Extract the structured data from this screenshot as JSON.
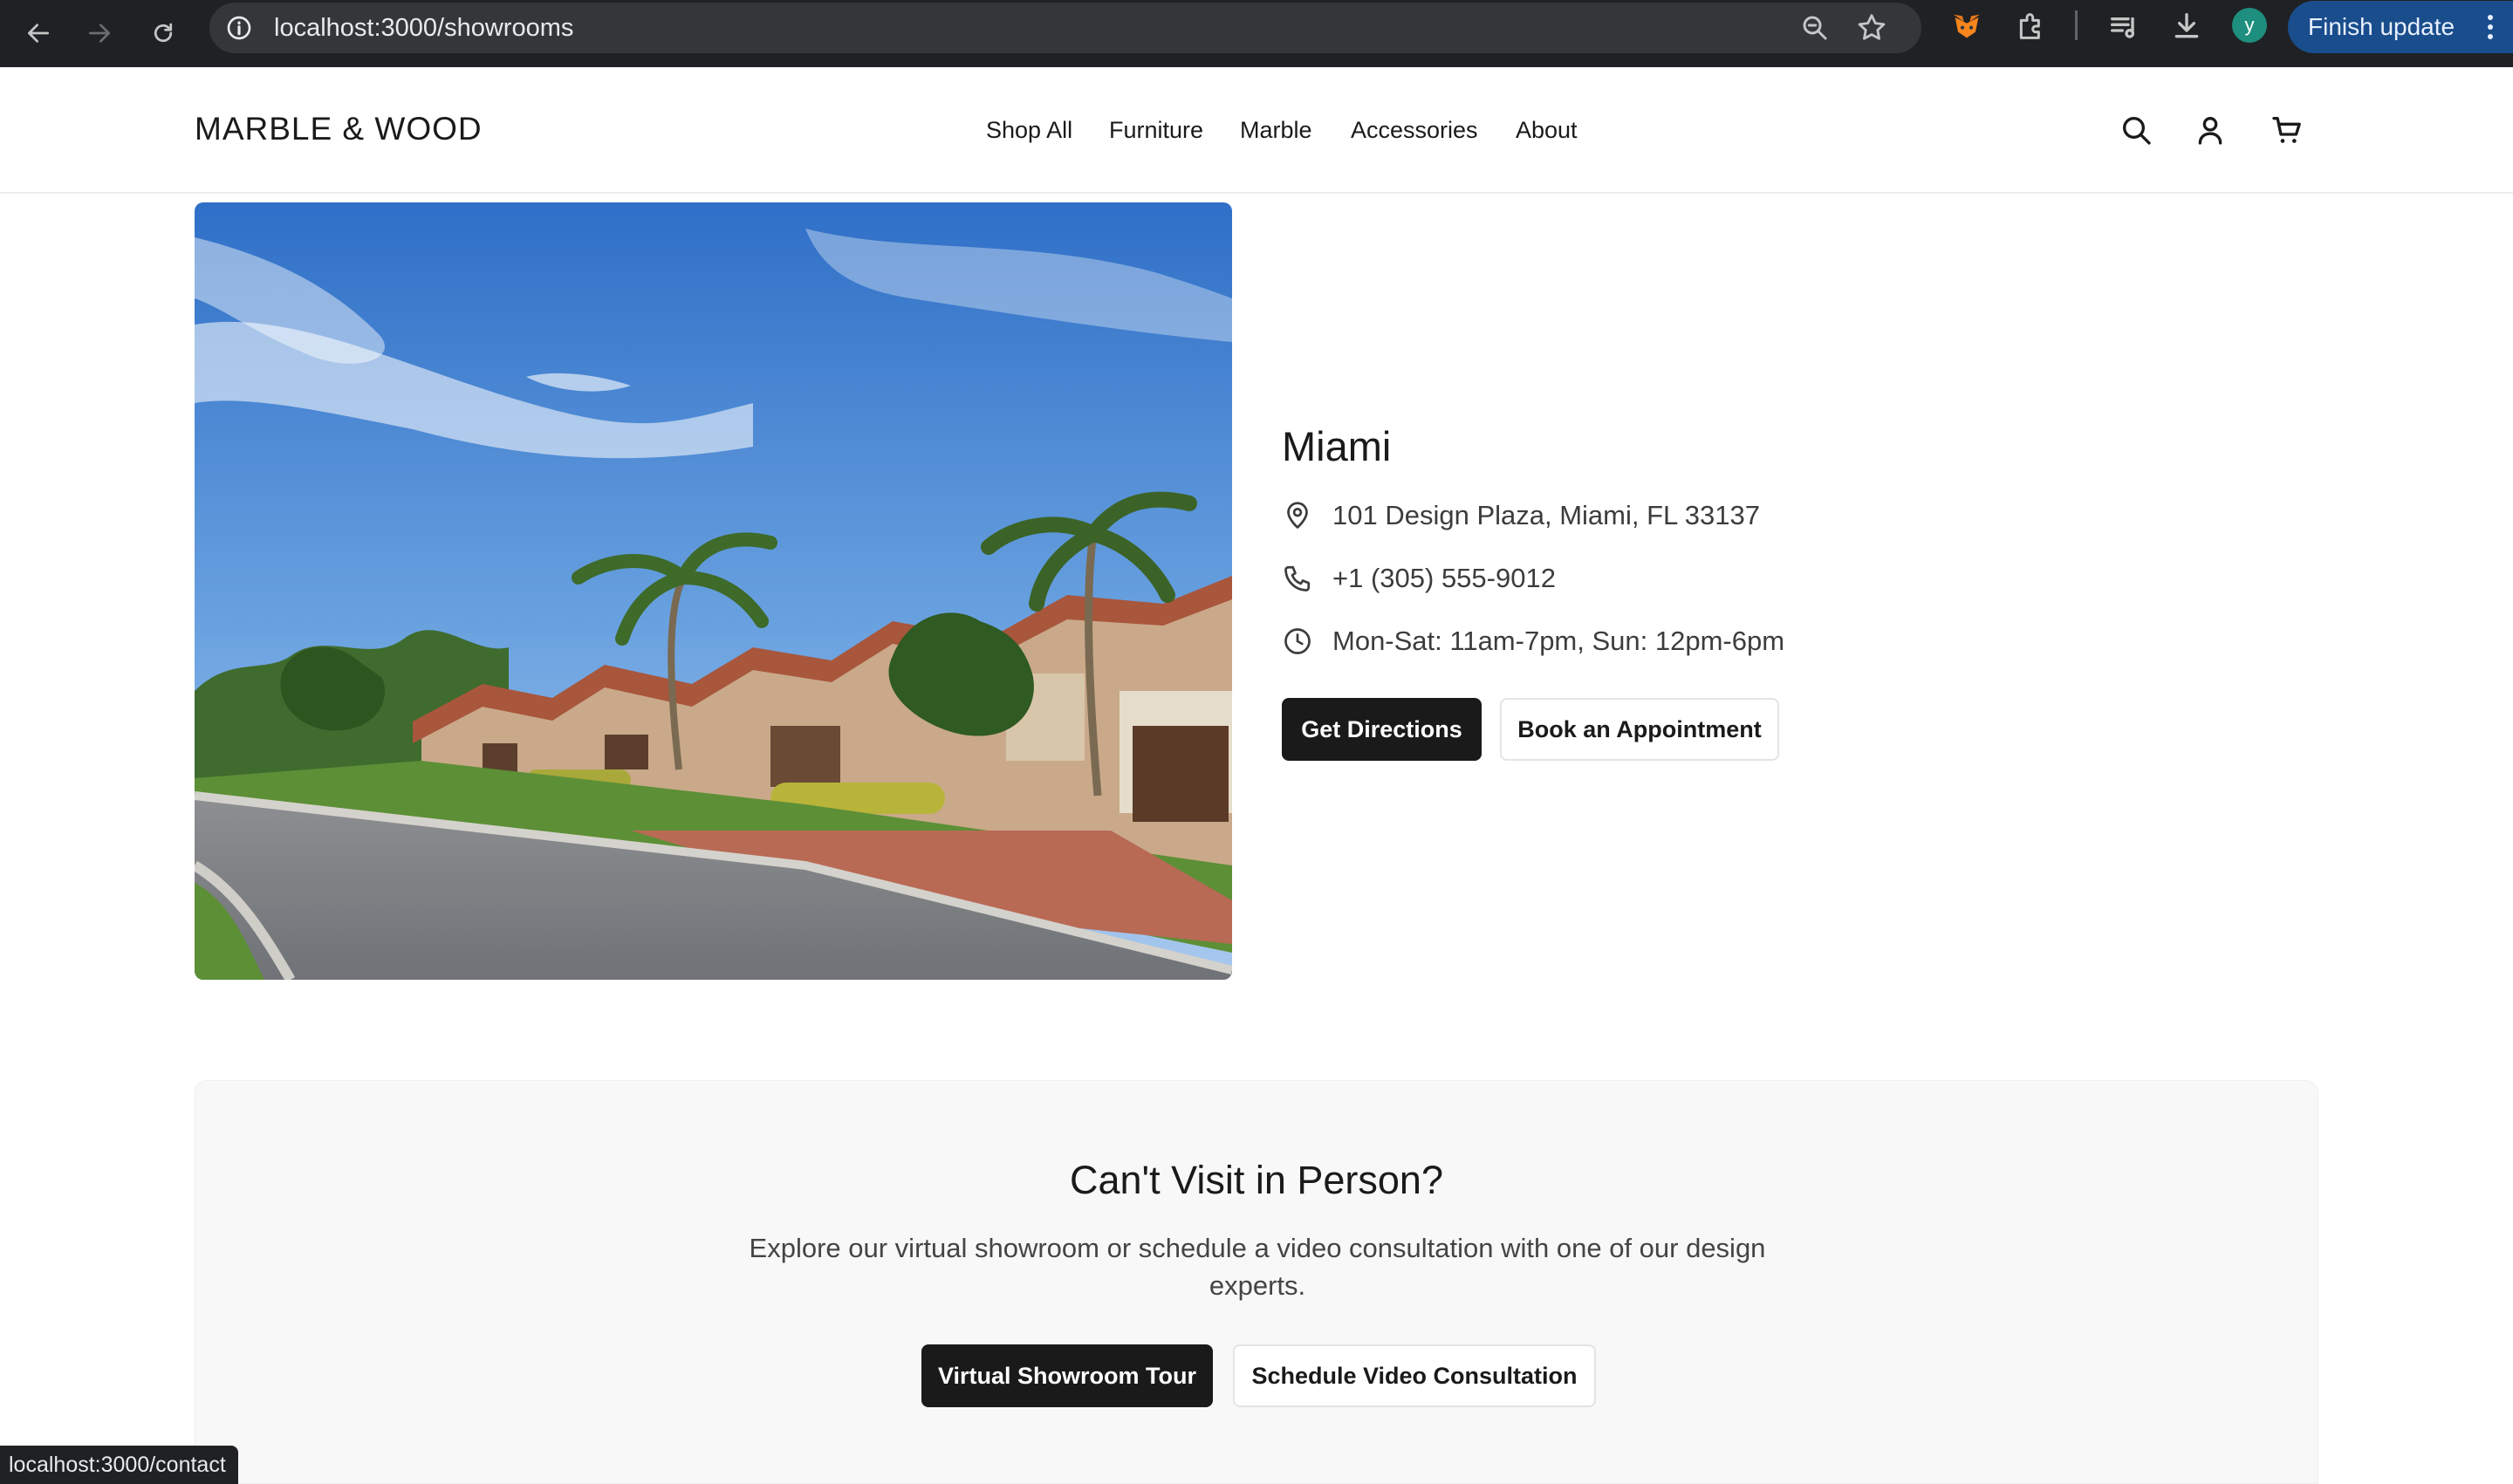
{
  "browser": {
    "url": "localhost:3000/showrooms",
    "profile_initial": "y",
    "update_label": "Finish update",
    "status_url": "localhost:3000/contact"
  },
  "header": {
    "logo": "MARBLE & WOOD",
    "nav": [
      "Shop All",
      "Furniture",
      "Marble",
      "Accessories",
      "About"
    ]
  },
  "showroom": {
    "city": "Miami",
    "address": "101 Design Plaza, Miami, FL 33137",
    "phone": "+1 (305) 555-9012",
    "hours": "Mon-Sat: 11am-7pm, Sun: 12pm-6pm",
    "directions_label": "Get Directions",
    "appointment_label": "Book an Appointment"
  },
  "virtual": {
    "title": "Can't Visit in Person?",
    "description": "Explore our virtual showroom or schedule a video consultation with one of our design experts.",
    "tour_label": "Virtual Showroom Tour",
    "consult_label": "Schedule Video Consultation"
  },
  "colors": {
    "chrome_bg": "#202124",
    "primary_button": "#1a1a1a",
    "update_button": "#1a4d8c"
  }
}
